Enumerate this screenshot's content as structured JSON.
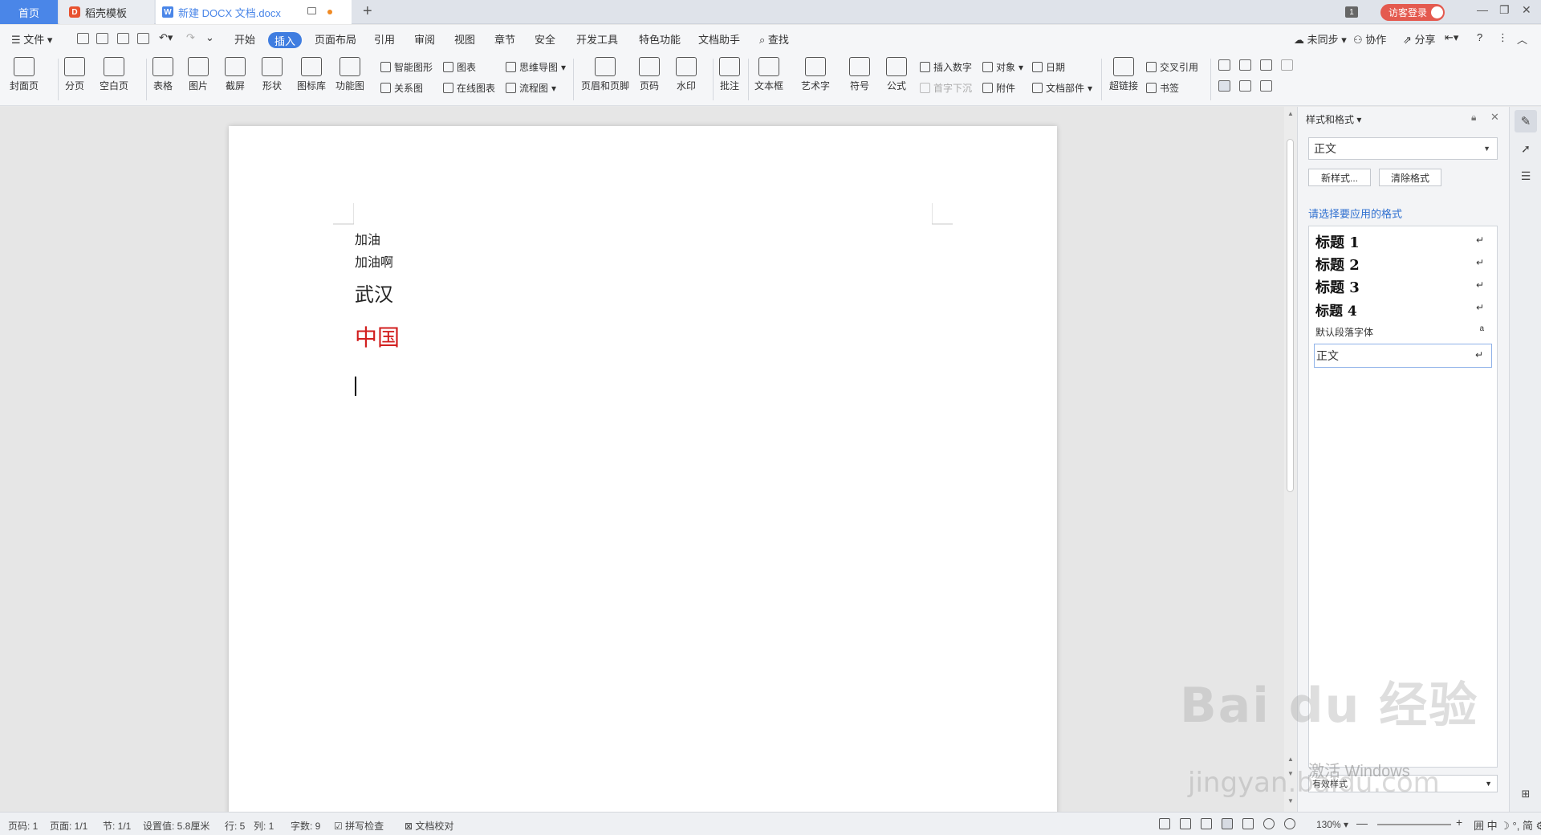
{
  "tabs": {
    "home": "首页",
    "template": "稻壳模板",
    "document": "新建 DOCX 文档.docx",
    "new_tab": "+"
  },
  "titlebar": {
    "window_count": "1",
    "login": "访客登录"
  },
  "menu": {
    "file": "文件",
    "items": [
      "开始",
      "插入",
      "页面布局",
      "引用",
      "审阅",
      "视图",
      "章节",
      "安全",
      "开发工具",
      "特色功能",
      "文档助手"
    ],
    "active": "插入",
    "search": "查找",
    "sync": "未同步",
    "collab": "协作",
    "share": "分享",
    "help": "?"
  },
  "ribbon": {
    "cover": "封面页",
    "page_break": "分页",
    "blank_page": "空白页",
    "table": "表格",
    "picture": "图片",
    "screenshot": "截屏",
    "shape": "形状",
    "icon_lib": "图标库",
    "func_chart": "功能图",
    "smart_shape": "智能图形",
    "relation": "关系图",
    "chart": "图表",
    "online_chart": "在线图表",
    "mindmap": "思维导图",
    "flowchart": "流程图",
    "header_footer": "页眉和页脚",
    "page_num": "页码",
    "watermark": "水印",
    "comment": "批注",
    "textbox": "文本框",
    "wordart": "艺术字",
    "symbol": "符号",
    "formula": "公式",
    "insert_number": "插入数字",
    "drop_cap": "首字下沉",
    "object": "对象",
    "attachment": "附件",
    "date": "日期",
    "doc_parts": "文档部件",
    "hyperlink": "超链接",
    "cross_ref": "交叉引用",
    "bookmark": "书签"
  },
  "document": {
    "lines": [
      "加油",
      "加油啊",
      "武汉",
      "中国"
    ],
    "red_color": "#d21f1f"
  },
  "panel": {
    "title": "样式和格式",
    "current_style": "正文",
    "new_style": "新样式...",
    "clear_format": "清除格式",
    "hint": "请选择要应用的格式",
    "styles": [
      "标题 1",
      "标题 2",
      "标题 3",
      "标题 4",
      "默认段落字体",
      "正文"
    ],
    "show": "有效样式"
  },
  "watermark": {
    "brand": "Bai du 经验",
    "url": "jingyan.baidu.com",
    "activate": "激活 Windows"
  },
  "statusbar": {
    "page_code": "页码: 1",
    "pages": "页面: 1/1",
    "section": "节: 1/1",
    "setting": "设置值: 5.8厘米",
    "row": "行: 5",
    "col": "列: 1",
    "words": "字数: 9",
    "spell": "拼写检查",
    "proof": "文档校对",
    "zoom": "130%",
    "ime": "中"
  },
  "colors": {
    "accent": "#3f7de0",
    "login": "#e45a4f"
  }
}
